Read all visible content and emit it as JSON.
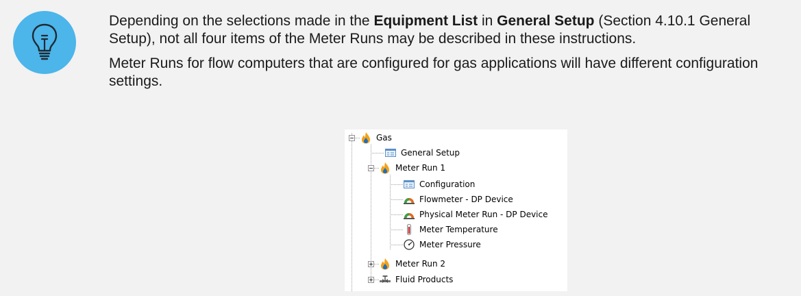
{
  "note": {
    "icon": "lightbulb-icon",
    "icon_color": "#4cb5ea",
    "p1_intro": "Depending on the selections made in the ",
    "p1_bold1": "Equipment List",
    "p1_mid": " in ",
    "p1_bold2": "General Setup",
    "p1_rest": " (Section 4.10.1 General Setup), not all four items of the Meter Runs may be described in these instructions.",
    "p2": "Meter Runs for flow computers that are configured for gas applications will have different configuration settings."
  },
  "tree": {
    "gas": {
      "label": "Gas",
      "icon": "flame-icon",
      "expanded": true
    },
    "general_setup": {
      "label": "General Setup",
      "icon": "form-icon"
    },
    "meter_run_1": {
      "label": "Meter Run 1",
      "icon": "flame-icon",
      "expanded": true
    },
    "configuration": {
      "label": "Configuration",
      "icon": "form-icon"
    },
    "flowmeter": {
      "label": "Flowmeter - DP Device",
      "icon": "dp-device-icon"
    },
    "physical_meter_run": {
      "label": "Physical Meter Run - DP Device",
      "icon": "dp-device-icon"
    },
    "meter_temperature": {
      "label": "Meter Temperature",
      "icon": "thermometer-icon"
    },
    "meter_pressure": {
      "label": "Meter Pressure",
      "icon": "pressure-gauge-icon"
    },
    "meter_run_2": {
      "label": "Meter Run 2",
      "icon": "flame-icon",
      "expanded": false
    },
    "fluid_products": {
      "label": "Fluid Products",
      "icon": "valve-icon",
      "expanded": false
    }
  }
}
